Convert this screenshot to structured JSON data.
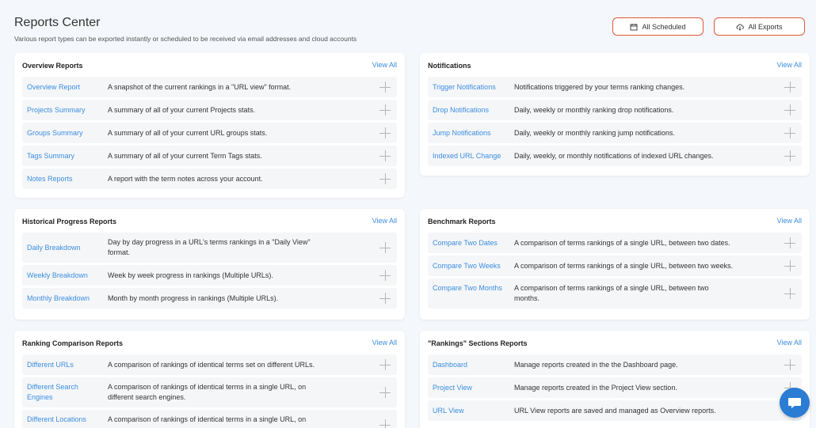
{
  "header": {
    "title": "Reports Center",
    "subtitle": "Various report types can be exported instantly or scheduled to be received via email addresses and cloud accounts",
    "scheduled_label": "All Scheduled",
    "exports_label": "All Exports"
  },
  "view_all": "View All",
  "overview": {
    "title": "Overview Reports",
    "rows": [
      {
        "label": "Overview Report",
        "desc": "A snapshot of the current rankings in a \"URL view\" format."
      },
      {
        "label": "Projects Summary",
        "desc": "A summary of all of your current Projects stats."
      },
      {
        "label": "Groups Summary",
        "desc": "A summary of all of your current URL groups stats."
      },
      {
        "label": "Tags Summary",
        "desc": "A summary of all of your current Term Tags stats."
      },
      {
        "label": "Notes Reports",
        "desc": "A report with the term notes across your account."
      }
    ]
  },
  "notifications": {
    "title": "Notifications",
    "rows": [
      {
        "label": "Trigger Notifications",
        "desc": "Notifications triggered by your terms ranking changes."
      },
      {
        "label": "Drop Notifications",
        "desc": "Daily, weekly or monthly ranking drop notifications."
      },
      {
        "label": "Jump Notifications",
        "desc": "Daily, weekly or monthly ranking jump notifications."
      },
      {
        "label": "Indexed URL Change",
        "desc": "Daily, weekly, or monthly notifications of indexed URL changes."
      }
    ]
  },
  "historical": {
    "title": "Historical Progress Reports",
    "rows": [
      {
        "label": "Daily Breakdown",
        "desc": "Day by day progress in a URL's terms rankings in a \"Daily View\" format."
      },
      {
        "label": "Weekly Breakdown",
        "desc": "Week by week progress in rankings (Multiple URLs)."
      },
      {
        "label": "Monthly Breakdown",
        "desc": "Month by month progress in rankings (Multiple URLs)."
      }
    ]
  },
  "benchmark": {
    "title": "Benchmark Reports",
    "rows": [
      {
        "label": "Compare Two Dates",
        "desc": "A comparison of terms rankings of a single URL, between two dates."
      },
      {
        "label": "Compare Two Weeks",
        "desc": "A comparison of terms rankings of a single URL, between two weeks."
      },
      {
        "label": "Compare Two Months",
        "desc": "A comparison of terms rankings of a single URL, between two months."
      }
    ]
  },
  "ranking": {
    "title": "Ranking Comparison Reports",
    "rows": [
      {
        "label": "Different URLs",
        "desc": "A comparison of rankings of identical terms set on different URLs."
      },
      {
        "label": "Different Search Engines",
        "desc": "A comparison of rankings of identical terms in a single URL, on different search engines."
      },
      {
        "label": "Different Locations",
        "desc": "A comparison of rankings of identical terms in a single URL, on"
      }
    ]
  },
  "sections": {
    "title": "\"Rankings\" Sections Reports",
    "rows": [
      {
        "label": "Dashboard",
        "desc": "Manage reports created in the the Dashboard page."
      },
      {
        "label": "Project View",
        "desc": "Manage reports created in the Project View section."
      },
      {
        "label": "URL View",
        "desc": "URL View reports are saved and managed as Overview reports."
      }
    ]
  },
  "colors": {
    "accent": "#3b8ee0",
    "header_button_border": "#e05a3a",
    "chat": "#2b7cd3"
  }
}
